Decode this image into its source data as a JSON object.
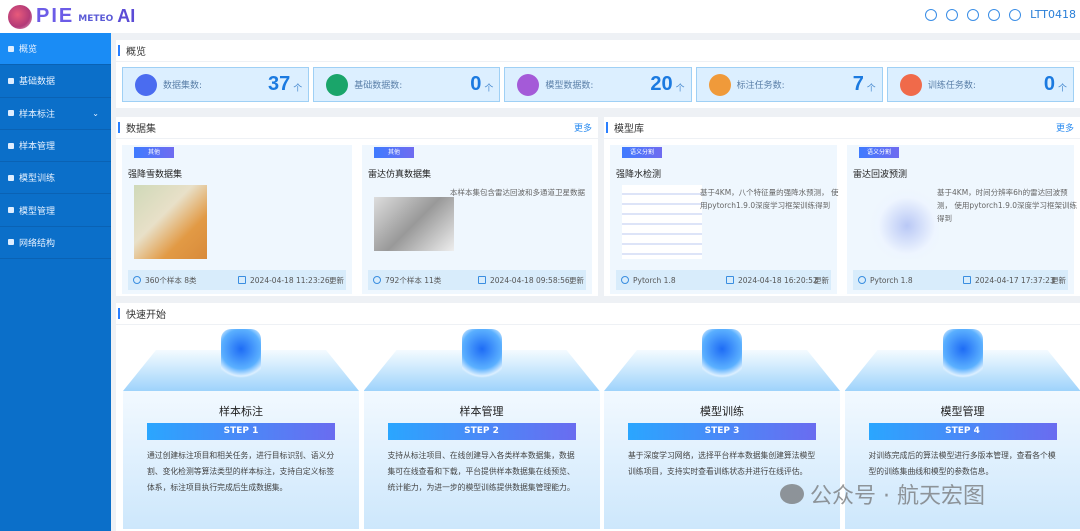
{
  "header": {
    "logo_text": "PIE METEOAI",
    "logo_main": "PIE",
    "logo_sub": "METEO",
    "logo_ai": "AI",
    "user": "LTT0418",
    "icons": [
      "home-icon",
      "help-icon",
      "bell-icon",
      "sliders-icon",
      "gear-icon"
    ]
  },
  "sidebar": {
    "items": [
      {
        "label": "概览",
        "icon": "overview-icon",
        "active": true
      },
      {
        "label": "基础数据",
        "icon": "data-icon"
      },
      {
        "label": "样本标注",
        "icon": "annotate-icon",
        "chevron": true
      },
      {
        "label": "样本管理",
        "icon": "sample-icon"
      },
      {
        "label": "模型训练",
        "icon": "train-icon"
      },
      {
        "label": "模型管理",
        "icon": "model-icon"
      },
      {
        "label": "网络结构",
        "icon": "network-icon"
      }
    ]
  },
  "overview": {
    "title": "概览",
    "stats": [
      {
        "label": "数据集数:",
        "value": "37",
        "unit": "个",
        "color": "#4a6cf0"
      },
      {
        "label": "基础数据数:",
        "value": "0",
        "unit": "个",
        "color": "#1aa56a"
      },
      {
        "label": "模型数据数:",
        "value": "20",
        "unit": "个",
        "color": "#a45ad8"
      },
      {
        "label": "标注任务数:",
        "value": "7",
        "unit": "个",
        "color": "#f09a3a"
      },
      {
        "label": "训练任务数:",
        "value": "0",
        "unit": "个",
        "color": "#f06a4a"
      }
    ]
  },
  "datasets": {
    "title": "数据集",
    "more": "更多",
    "cards": [
      {
        "tag": "其他",
        "name": "强降雪数据集",
        "desc": "",
        "samples": "360个样本 8类",
        "date": "2024-04-18 11:23:26",
        "update": "更新"
      },
      {
        "tag": "其他",
        "name": "雷达仿真数据集",
        "desc": "本样本集包含雷达回波和多通道卫星数据",
        "samples": "792个样本 11类",
        "date": "2024-04-18 09:58:56",
        "update": "更新"
      }
    ]
  },
  "models": {
    "title": "模型库",
    "more": "更多",
    "cards": [
      {
        "tag": "语义分割",
        "name": "强降水检测",
        "desc": "基于4KM，八个特征量的强降水预测， 使用pytorch1.9.0深度学习框架训练得到",
        "framework": "Pytorch 1.8",
        "date": "2024-04-18 16:20:52",
        "update": "更新"
      },
      {
        "tag": "语义分割",
        "name": "雷达回波预测",
        "desc": "基于4KM，时间分辨率6h的雷达回波预测， 使用pytorch1.9.0深度学习框架训练得到",
        "framework": "Pytorch 1.8",
        "date": "2024-04-17 17:37:23",
        "update": "更新"
      }
    ]
  },
  "quickstart": {
    "title": "快速开始",
    "steps": [
      {
        "name": "样本标注",
        "step": "STEP 1",
        "desc": "通过创建标注项目和相关任务，进行目标识别、语义分割、变化检测等算法类型的样本标注，支持自定义标签体系，标注项目执行完成后生成数据集。"
      },
      {
        "name": "样本管理",
        "step": "STEP 2",
        "desc": "支持从标注项目、在线创建导入各类样本数据集，数据集可在线查看和下载，平台提供样本数据集在线预览、统计能力，为进一步的模型训练提供数据集管理能力。"
      },
      {
        "name": "模型训练",
        "step": "STEP 3",
        "desc": "基于深度学习网络，选择平台样本数据集创建算法模型训练项目，支持实时查看训练状态并进行在线评估。"
      },
      {
        "name": "模型管理",
        "step": "STEP 4",
        "desc": "对训练完成后的算法模型进行多版本管理，查看各个模型的训练集曲线和模型的参数信息。"
      }
    ]
  },
  "watermark": "公众号 · 航天宏图"
}
